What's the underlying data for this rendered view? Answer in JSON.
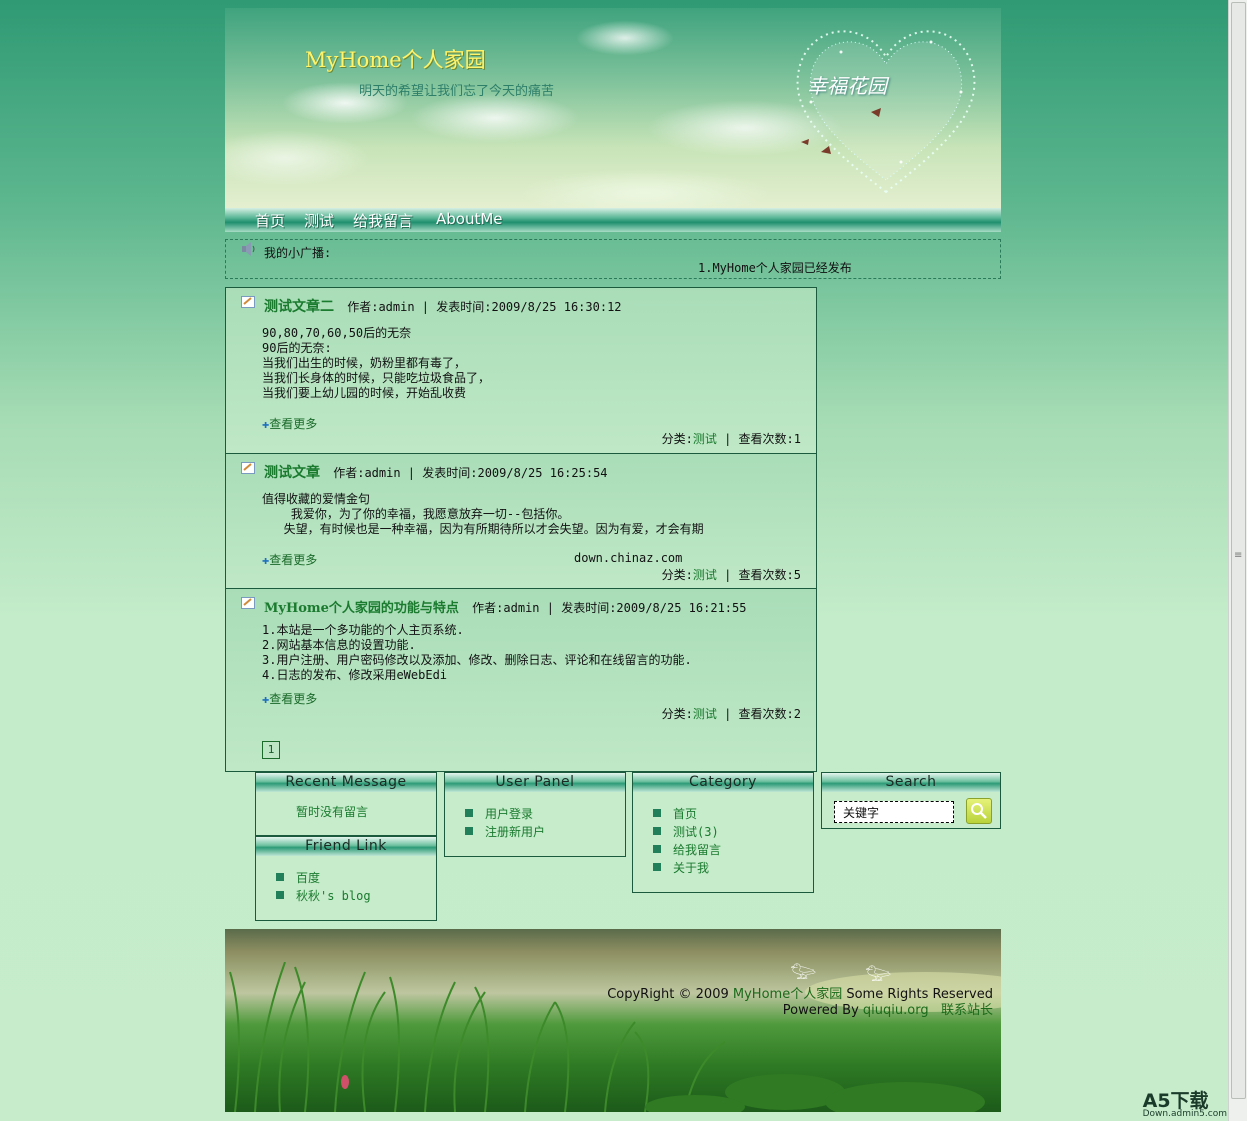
{
  "header": {
    "site_title": "MyHome个人家园",
    "slogan": "明天的希望让我们忘了今天的痛苦",
    "banner_text": "幸福花园"
  },
  "nav": {
    "items": [
      "首页",
      "测试",
      "给我留言",
      "AboutMe"
    ]
  },
  "broadcast": {
    "label": "我的小广播:",
    "text": "1.MyHome个人家园已经发布"
  },
  "posts": [
    {
      "title": "测试文章二",
      "meta": "作者:admin | 发表时间:2009/8/25 16:30:12",
      "body": "90,80,70,60,50后的无奈\n90后的无奈:\n当我们出生的时候，奶粉里都有毒了，\n当我们长身体的时候，只能吃垃圾食品了，\n当我们要上幼儿园的时候，开始乱收费",
      "more": "查看更多",
      "extra": "",
      "category_label": "分类:",
      "category": "测试",
      "views": "查看次数:1"
    },
    {
      "title": "测试文章",
      "meta": "作者:admin | 发表时间:2009/8/25 16:25:54",
      "body": "值得收藏的爱情金句\n    我爱你，为了你的幸福，我愿意放弃一切--包括你。\n   失望，有时候也是一种幸福，因为有所期待所以才会失望。因为有爱，才会有期",
      "more": "查看更多",
      "extra": "down.chinaz.com",
      "category_label": "分类:",
      "category": "测试",
      "views": "查看次数:5"
    },
    {
      "title": "MyHome个人家园的功能与特点",
      "meta": "作者:admin | 发表时间:2009/8/25 16:21:55",
      "body": "1.本站是一个多功能的个人主页系统.\n2.网站基本信息的设置功能.\n3.用户注册、用户密码修改以及添加、修改、删除日志、评论和在线留言的功能.\n4.日志的发布、修改采用eWebEdi",
      "more": "查看更多",
      "extra": "",
      "category_label": "分类:",
      "category": "测试",
      "views": "查看次数:2"
    }
  ],
  "pager": {
    "page": "1"
  },
  "widgets": {
    "recent_message": {
      "title": "Recent Message",
      "empty": "暂时没有留言"
    },
    "friend_link": {
      "title": "Friend Link",
      "items": [
        "百度",
        "秋秋's blog"
      ]
    },
    "user_panel": {
      "title": "User Panel",
      "items": [
        "用户登录",
        "注册新用户"
      ]
    },
    "category": {
      "title": "Category",
      "items": [
        "首页",
        "测试(3)",
        "给我留言",
        "关于我"
      ]
    },
    "search": {
      "title": "Search",
      "placeholder": "关键字"
    }
  },
  "footer": {
    "copyright_prefix": "CopyRight © 2009",
    "site_link": "MyHome个人家园",
    "rights": "Some Rights Reserved",
    "powered_by": "Powered By",
    "powered_link": "qiuqiu.org",
    "contact": "联系站长"
  },
  "watermark": {
    "brand": "A5下载",
    "url": "Down.admin5.com"
  },
  "colors": {
    "accent_green": "#1a7a2e",
    "border": "#1b5a3c",
    "title_yellow": "#fff36a"
  }
}
